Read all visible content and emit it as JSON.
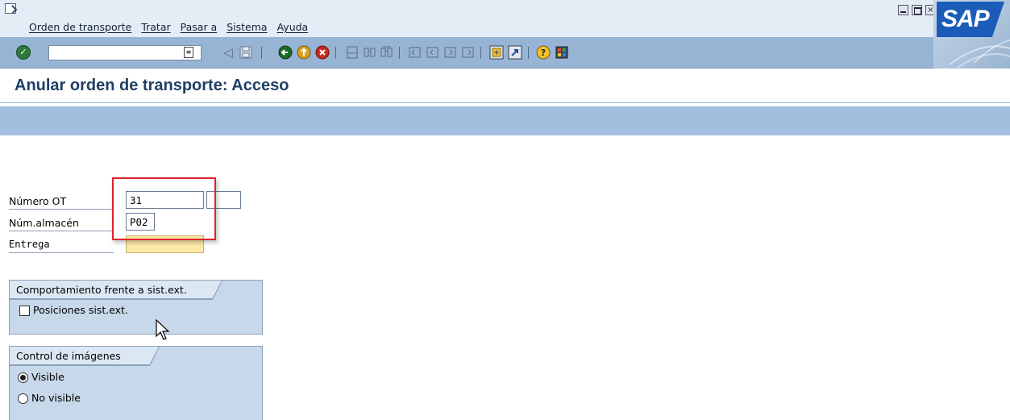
{
  "menu": {
    "items": [
      "Orden de transporte",
      "Tratar",
      "Pasar a",
      "Sistema",
      "Ayuda"
    ]
  },
  "window": {
    "close_glyph": "×"
  },
  "logo": {
    "text": "SAP"
  },
  "toolbar": {
    "command_value": "",
    "icons": [
      "enter-icon",
      "back-icon",
      "exit-icon",
      "cancel-icon",
      "print-icon",
      "find-icon",
      "find-next-icon",
      "first-page-icon",
      "previous-page-icon",
      "next-page-icon",
      "last-page-icon",
      "create-session-icon",
      "shortcut-icon",
      "help-icon",
      "layout-menu-icon"
    ],
    "nav_left_glyph": "◁"
  },
  "page": {
    "title": "Anular orden de transporte: Acceso"
  },
  "form": {
    "numero_ot": {
      "label": "Número OT",
      "value": "31",
      "value2": ""
    },
    "num_almacen": {
      "label": "Núm.almacén",
      "value": "P02"
    },
    "entrega": {
      "label": "Entrega",
      "value": ""
    }
  },
  "group_ext": {
    "title": "Comportamiento frente a sist.ext.",
    "checkbox_label": "Posiciones sist.ext.",
    "checked": false
  },
  "group_images": {
    "title": "Control de imágenes",
    "options": [
      "Visible",
      "No visible"
    ],
    "selected": "Visible"
  },
  "colors": {
    "title_text": "#1e3f66",
    "toolbar_bg": "#98b4d4",
    "highlight": "#e0242a",
    "required_field": "#fbe9a8"
  }
}
